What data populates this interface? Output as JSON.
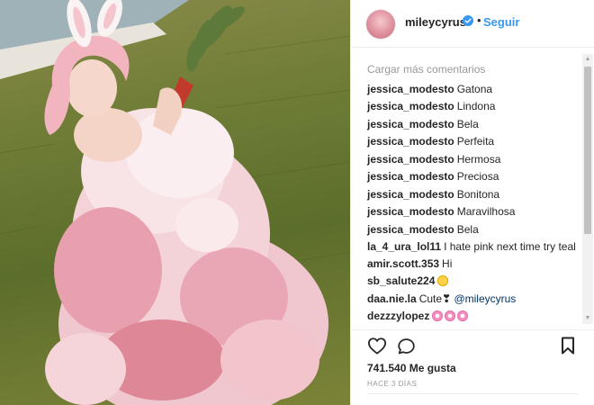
{
  "post": {
    "username": "mileycyrus",
    "follow_label": "Seguir",
    "separator": "•"
  },
  "comments": {
    "load_more_label": "Cargar más comentarios",
    "items": [
      {
        "user": "jessica_modesto",
        "text": "Gatona"
      },
      {
        "user": "jessica_modesto",
        "text": "Lindona"
      },
      {
        "user": "jessica_modesto",
        "text": "Bela"
      },
      {
        "user": "jessica_modesto",
        "text": "Perfeita"
      },
      {
        "user": "jessica_modesto",
        "text": "Hermosa"
      },
      {
        "user": "jessica_modesto",
        "text": "Preciosa"
      },
      {
        "user": "jessica_modesto",
        "text": "Bonitona"
      },
      {
        "user": "jessica_modesto",
        "text": "Maravilhosa"
      },
      {
        "user": "jessica_modesto",
        "text": "Bela"
      },
      {
        "user": "la_4_ura_lol11",
        "text": "I hate pink next time try teal"
      },
      {
        "user": "amir.scott.353",
        "text": "Hi"
      },
      {
        "user": "sb_salute224",
        "text": "",
        "emoji": "smile"
      },
      {
        "user": "daa.nie.la",
        "text": "Cute❣",
        "mention": "@mileycyrus"
      },
      {
        "user": "dezzzylopez",
        "text": "",
        "emoji": "flower-x3"
      }
    ]
  },
  "actions": {
    "like_icon": "heart-outline-icon",
    "comment_icon": "speech-bubble-icon",
    "save_icon": "bookmark-outline-icon",
    "likes_text": "741.540 Me gusta",
    "timestamp": "HACE 3 DÍAS"
  },
  "colors": {
    "link_blue": "#3897f0",
    "mention_blue": "#003569",
    "muted": "#999999",
    "text": "#262626",
    "verified_badge": "#3897f0"
  }
}
